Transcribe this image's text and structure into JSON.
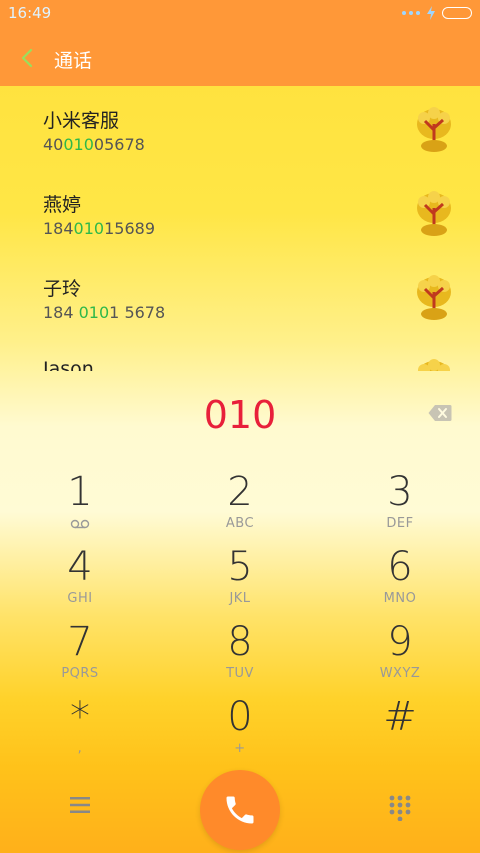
{
  "status": {
    "time": "16:49"
  },
  "header": {
    "title": "通话"
  },
  "contacts": [
    {
      "name": "小米客服",
      "num_pre": "40",
      "num_hl": "010",
      "num_post": "05678"
    },
    {
      "name": "燕婷",
      "num_pre": "184",
      "num_hl": "010",
      "num_post": "15689"
    },
    {
      "name": "子玲",
      "num_pre": "184 ",
      "num_hl": "010",
      "num_post": "1 5678"
    },
    {
      "name": "Jason",
      "num_pre": "",
      "num_hl": "",
      "num_post": ""
    }
  ],
  "dialer": {
    "number": "010",
    "keys": [
      {
        "digit": "1",
        "letters": ""
      },
      {
        "digit": "2",
        "letters": "ABC"
      },
      {
        "digit": "3",
        "letters": "DEF"
      },
      {
        "digit": "4",
        "letters": "GHI"
      },
      {
        "digit": "5",
        "letters": "JKL"
      },
      {
        "digit": "6",
        "letters": "MNO"
      },
      {
        "digit": "7",
        "letters": "PQRS"
      },
      {
        "digit": "8",
        "letters": "TUV"
      },
      {
        "digit": "9",
        "letters": "WXYZ"
      },
      {
        "digit": "*",
        "letters": ","
      },
      {
        "digit": "0",
        "letters": "+"
      },
      {
        "digit": "#",
        "letters": ""
      }
    ]
  },
  "icons": {
    "back": "back-chevron-icon",
    "backspace": "backspace-icon",
    "voicemail": "voicemail-icon",
    "menu": "menu-icon",
    "call": "phone-icon",
    "dialpad": "dialpad-icon"
  },
  "colors": {
    "accent": "#ff9838",
    "highlight": "#2fb84a",
    "number": "#e8203a"
  }
}
